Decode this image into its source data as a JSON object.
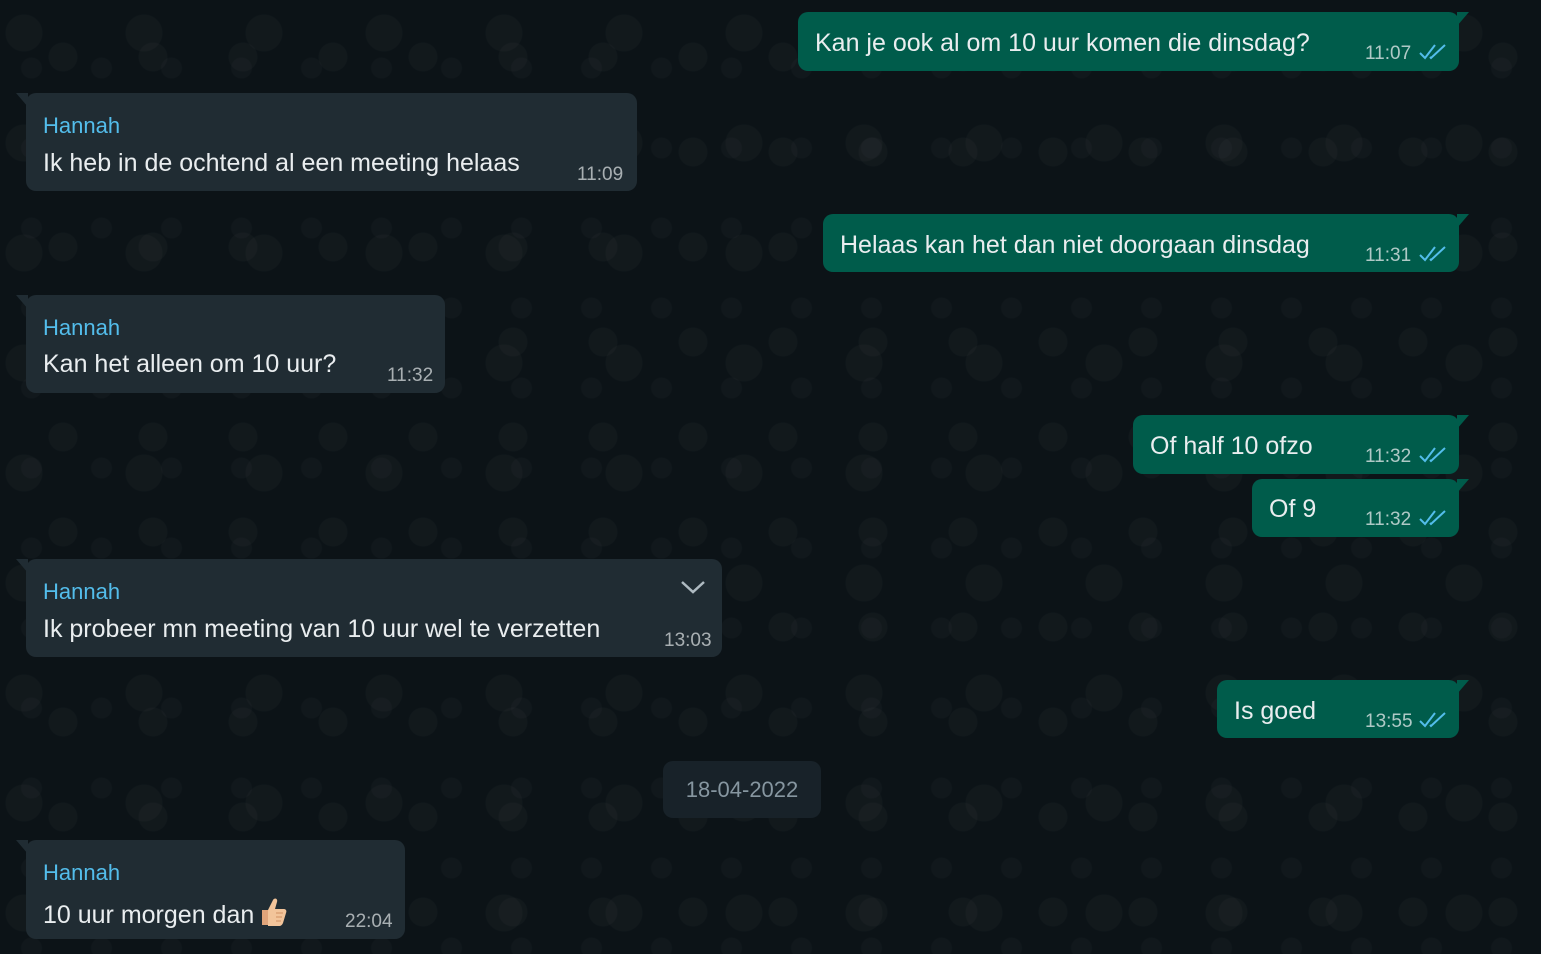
{
  "messages": [
    {
      "direction": "out",
      "text": "Kan je ook al om 10 uur komen die dinsdag?",
      "time": "11:07",
      "status": "read"
    },
    {
      "direction": "in",
      "sender": "Hannah",
      "text": "Ik heb in de ochtend al een meeting helaas",
      "time": "11:09"
    },
    {
      "direction": "out",
      "text": "Helaas kan het dan niet doorgaan dinsdag",
      "time": "11:31",
      "status": "read"
    },
    {
      "direction": "in",
      "sender": "Hannah",
      "text": "Kan het alleen om 10 uur?",
      "time": "11:32"
    },
    {
      "direction": "out",
      "text": "Of half 10 ofzo",
      "time": "11:32",
      "status": "read"
    },
    {
      "direction": "out",
      "text": "Of 9",
      "time": "11:32",
      "status": "read"
    },
    {
      "direction": "in",
      "sender": "Hannah",
      "text": "Ik probeer mn meeting van 10 uur wel te verzetten",
      "time": "13:03"
    },
    {
      "direction": "out",
      "text": "Is goed",
      "time": "13:55",
      "status": "read"
    },
    {
      "direction": "in",
      "sender": "Hannah",
      "text": "10 uur morgen dan",
      "emoji": "thumbs-up",
      "time": "22:04"
    }
  ],
  "date_divider": "18-04-2022",
  "colors": {
    "incoming_bubble": "#202c33",
    "outgoing_bubble": "#005c4b",
    "sender_name": "#53bdeb",
    "read_ticks": "#53bdeb",
    "background": "#0b141a"
  },
  "icons": {
    "read_receipt": "double-check-icon",
    "menu": "chevron-down-icon",
    "emoji": "thumbs-up-icon"
  }
}
